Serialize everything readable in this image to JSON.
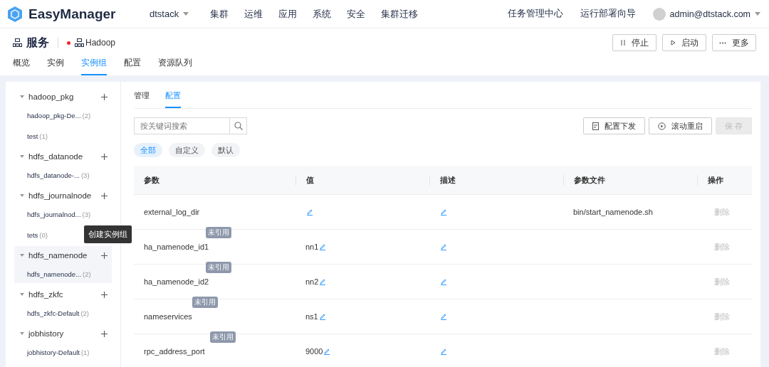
{
  "topbar": {
    "logo": "EasyManager",
    "cluster": "dtstack",
    "menu": [
      "集群",
      "运维",
      "应用",
      "系统",
      "安全",
      "集群迁移"
    ],
    "links": [
      "任务管理中心",
      "运行部署向导"
    ],
    "user": "admin@dtstack.com"
  },
  "service": {
    "title": "服务",
    "name": "Hadoop",
    "actions": [
      {
        "kind": "pause",
        "label": "停止"
      },
      {
        "kind": "play",
        "label": "启动"
      },
      {
        "kind": "more",
        "label": "更多"
      }
    ]
  },
  "tabs": [
    {
      "label": "概览",
      "selected": false
    },
    {
      "label": "实例",
      "selected": false
    },
    {
      "label": "实例组",
      "selected": true
    },
    {
      "label": "配置",
      "selected": false
    },
    {
      "label": "资源队列",
      "selected": false
    }
  ],
  "groups": [
    {
      "name": "hadoop_pkg",
      "hovered": false,
      "children": [
        {
          "name": "hadoop_pkg-De...",
          "count": "(2)",
          "selected": false
        },
        {
          "name": "test",
          "count": "(1)",
          "selected": false
        }
      ]
    },
    {
      "name": "hdfs_datanode",
      "hovered": false,
      "children": [
        {
          "name": "hdfs_datanode-...",
          "count": "(3)",
          "selected": false
        }
      ]
    },
    {
      "name": "hdfs_journalnode",
      "hovered": false,
      "children": [
        {
          "name": "hdfs_journalnod...",
          "count": "(3)",
          "selected": false
        },
        {
          "name": "tets",
          "count": "(0)",
          "selected": false
        }
      ]
    },
    {
      "name": "hdfs_namenode",
      "hovered": true,
      "tooltip": "创建实例组",
      "children": [
        {
          "name": "hdfs_namenode...",
          "count": "(2)",
          "selected": true
        }
      ]
    },
    {
      "name": "hdfs_zkfc",
      "hovered": false,
      "children": [
        {
          "name": "hdfs_zkfc-Default",
          "count": "(2)",
          "selected": false
        }
      ]
    },
    {
      "name": "jobhistory",
      "hovered": false,
      "children": [
        {
          "name": "jobhistory-Default",
          "count": "(1)",
          "selected": false
        }
      ]
    }
  ],
  "subtabs": [
    {
      "label": "管理",
      "selected": false
    },
    {
      "label": "配置",
      "selected": true
    }
  ],
  "search": {
    "placeholder": "按关键词搜索"
  },
  "toolbar": [
    {
      "kind": "file",
      "label": "配置下发",
      "disabled": false
    },
    {
      "kind": "restart",
      "label": "滚动重启",
      "disabled": false
    },
    {
      "kind": "none",
      "label": "保 存",
      "disabled": true
    }
  ],
  "filters": [
    {
      "label": "全部",
      "selected": true
    },
    {
      "label": "自定义",
      "selected": false
    },
    {
      "label": "默认",
      "selected": false
    }
  ],
  "table": {
    "columns": [
      "参数",
      "值",
      "描述",
      "参数文件",
      "操作"
    ],
    "rows": [
      {
        "param": "external_log_dir",
        "file": "bin/start_namenode.sh",
        "action": "删除"
      },
      {
        "param": "ha_namenode_id1",
        "tag": "未引用",
        "value": "nn1",
        "action": "删除"
      },
      {
        "param": "ha_namenode_id2",
        "tag": "未引用",
        "value": "nn2",
        "action": "删除"
      },
      {
        "param": "nameservices",
        "tag": "未引用",
        "value": "ns1",
        "action": "删除"
      },
      {
        "param": "rpc_address_port",
        "tag": "未引用",
        "value": "9000",
        "action": "删除"
      }
    ]
  }
}
